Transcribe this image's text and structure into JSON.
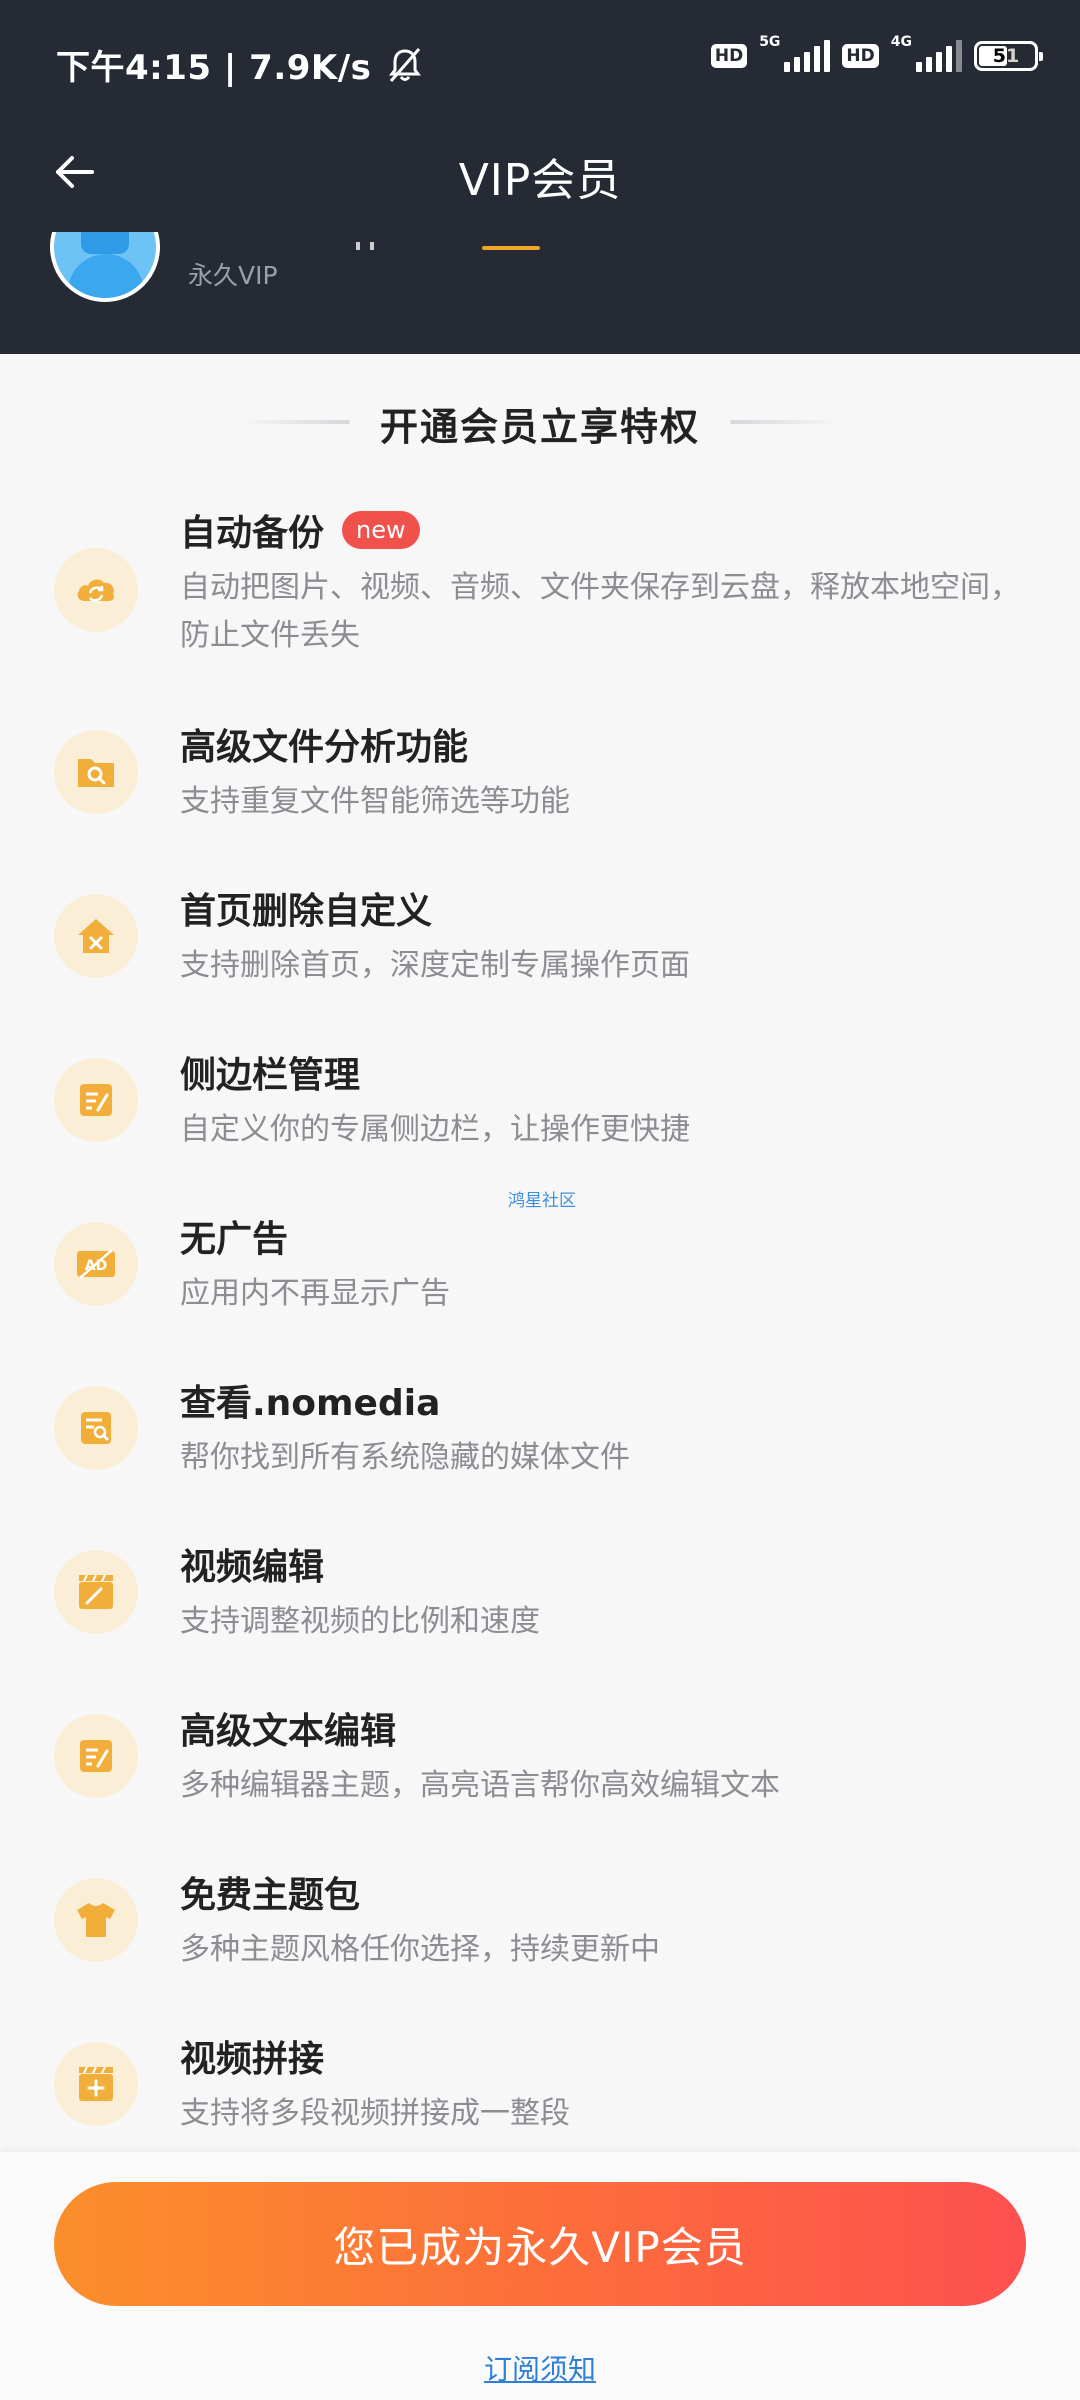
{
  "status_bar": {
    "time_speed": "下午4:15 | 7.9K/s",
    "hd1": "HD",
    "net1": "5G",
    "hd2": "HD",
    "net2": "4G",
    "battery": "51"
  },
  "header": {
    "title": "VIP会员"
  },
  "profile": {
    "level": "永久VIP"
  },
  "section": {
    "title": "开通会员立享特权"
  },
  "features": [
    {
      "title": "自动备份",
      "badge": "new",
      "desc": "自动把图片、视频、音频、文件夹保存到云盘，释放本地空间，防止文件丢失",
      "icon": "cloud-sync-icon"
    },
    {
      "title": "高级文件分析功能",
      "desc": "支持重复文件智能筛选等功能",
      "icon": "folder-search-icon"
    },
    {
      "title": "首页删除自定义",
      "desc": "支持删除首页，深度定制专属操作页面",
      "icon": "home-delete-icon"
    },
    {
      "title": "侧边栏管理",
      "desc": "自定义你的专属侧边栏，让操作更快捷",
      "icon": "edit-note-icon"
    },
    {
      "title": "无广告",
      "desc": "应用内不再显示广告",
      "icon": "ad-block-icon"
    },
    {
      "title": "查看.nomedia",
      "desc": "帮你找到所有系统隐藏的媒体文件",
      "icon": "file-search-icon"
    },
    {
      "title": "视频编辑",
      "desc": "支持调整视频的比例和速度",
      "icon": "clapper-edit-icon"
    },
    {
      "title": "高级文本编辑",
      "desc": "多种编辑器主题，高亮语言帮你高效编辑文本",
      "icon": "text-edit-icon"
    },
    {
      "title": "免费主题包",
      "desc": "多种主题风格任你选择，持续更新中",
      "icon": "tshirt-icon"
    },
    {
      "title": "视频拼接",
      "desc": "支持将多段视频拼接成一整段",
      "icon": "video-add-icon"
    }
  ],
  "watermark": "鸿星社区",
  "bottom": {
    "cta_label": "您已成为永久VIP会员",
    "terms_label": "订阅须知"
  },
  "colors": {
    "header_bg": "#252a34",
    "accent_orange": "#fb8f2c",
    "accent_red": "#fd5050",
    "icon_bg": "#faeed7",
    "icon_fg": "#f2ae3a",
    "link": "#2e7fd8"
  }
}
